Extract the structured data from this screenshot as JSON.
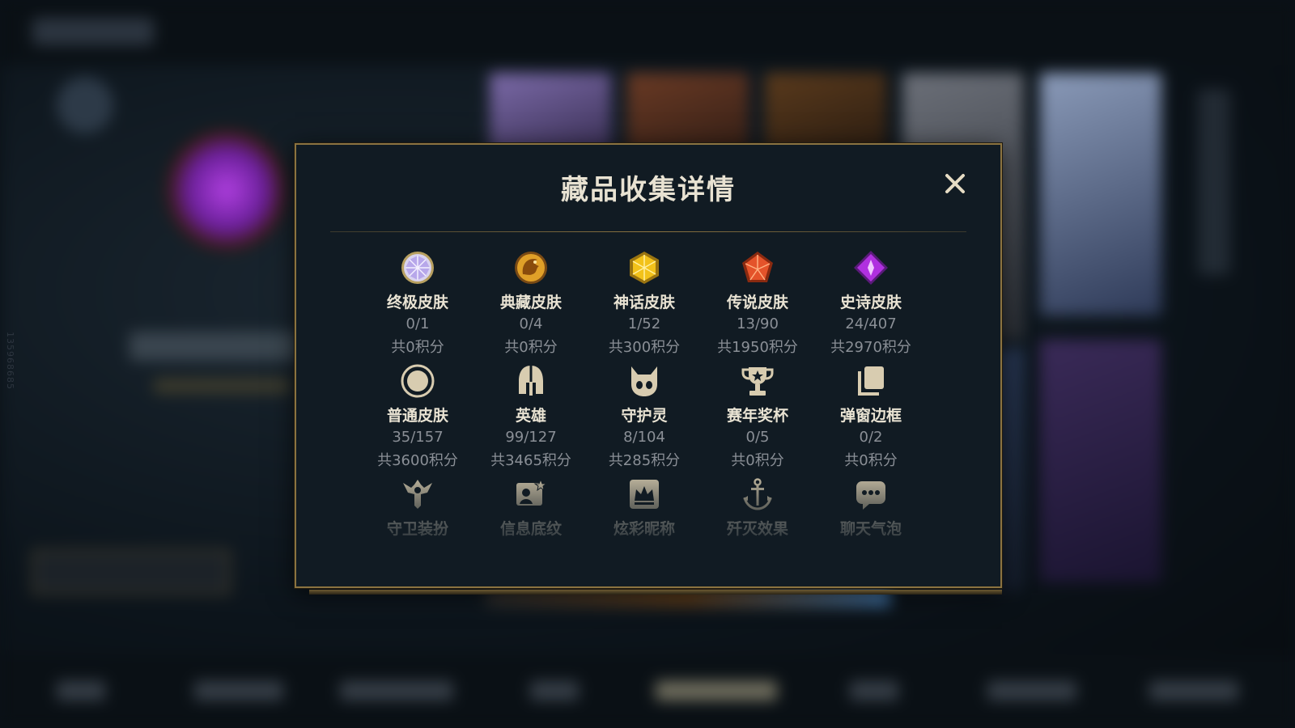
{
  "modal": {
    "title": "藏品收集详情",
    "close_icon": "close-icon",
    "items": [
      {
        "icon": "ultimate-skin-icon",
        "name": "终极皮肤",
        "count": "0/1",
        "points": "共0积分"
      },
      {
        "icon": "prestige-skin-icon",
        "name": "典藏皮肤",
        "count": "0/4",
        "points": "共0积分"
      },
      {
        "icon": "mythic-skin-icon",
        "name": "神话皮肤",
        "count": "1/52",
        "points": "共300积分"
      },
      {
        "icon": "legendary-skin-icon",
        "name": "传说皮肤",
        "count": "13/90",
        "points": "共1950积分"
      },
      {
        "icon": "epic-skin-icon",
        "name": "史诗皮肤",
        "count": "24/407",
        "points": "共2970积分"
      },
      {
        "icon": "common-skin-icon",
        "name": "普通皮肤",
        "count": "35/157",
        "points": "共3600积分"
      },
      {
        "icon": "champion-helmet-icon",
        "name": "英雄",
        "count": "99/127",
        "points": "共3465积分"
      },
      {
        "icon": "guardian-icon",
        "name": "守护灵",
        "count": "8/104",
        "points": "共285积分"
      },
      {
        "icon": "trophy-icon",
        "name": "赛年奖杯",
        "count": "0/5",
        "points": "共0积分"
      },
      {
        "icon": "popup-frame-icon",
        "name": "弹窗边框",
        "count": "0/2",
        "points": "共0积分"
      },
      {
        "icon": "ward-skin-icon",
        "name": "守卫装扮",
        "count": "",
        "points": ""
      },
      {
        "icon": "banner-icon",
        "name": "信息底纹",
        "count": "",
        "points": ""
      },
      {
        "icon": "crown-nameplate-icon",
        "name": "炫彩昵称",
        "count": "",
        "points": ""
      },
      {
        "icon": "finisher-icon",
        "name": "歼灭效果",
        "count": "",
        "points": ""
      },
      {
        "icon": "chat-bubble-icon",
        "name": "聊天气泡",
        "count": "",
        "points": ""
      }
    ]
  },
  "colors": {
    "accent_gold": "#8b7340",
    "title_text": "#e8e2d2",
    "secondary_text": "#8a8f96",
    "panel_bg": "#111b23"
  },
  "watermark": "135968685"
}
